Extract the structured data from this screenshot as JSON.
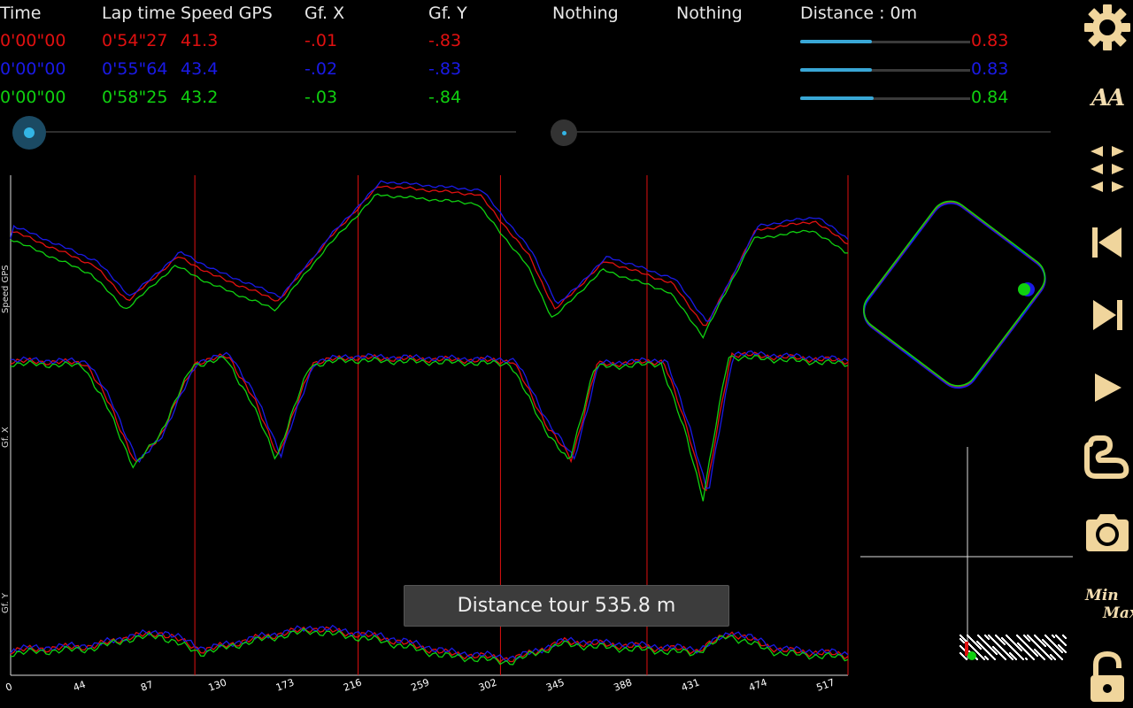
{
  "header": {
    "columns": [
      "Time",
      "Lap time",
      "Speed GPS",
      "Gf. X",
      "Gf. Y",
      "Nothing",
      "Nothing"
    ],
    "distance_label": "Distance : 0m"
  },
  "laps": [
    {
      "color": "#e01010",
      "time": "0'00\"00",
      "lap_time": "0'54\"27",
      "speed": "41.3",
      "gfx": "-.01",
      "gfy": "-.83",
      "dist_value": "0.83"
    },
    {
      "color": "#1a1ae6",
      "time": "0'00\"00",
      "lap_time": "0'55\"64",
      "speed": "43.4",
      "gfx": "-.02",
      "gfy": "-.83",
      "dist_value": "0.83"
    },
    {
      "color": "#10d010",
      "time": "0'00\"00",
      "lap_time": "0'58\"25",
      "speed": "43.2",
      "gfx": "-.03",
      "gfy": "-.84",
      "dist_value": "0.84"
    }
  ],
  "distance_bars_fill": [
    0.42,
    0.42,
    0.43
  ],
  "graph": {
    "y_labels": [
      "Speed GPS",
      "Gf. X",
      "Gf. Y"
    ],
    "x_ticks": [
      "0",
      "44",
      "87",
      "130",
      "173",
      "216",
      "259",
      "302",
      "345",
      "388",
      "431",
      "474",
      "517"
    ],
    "sector_markers": [
      0.22,
      0.415,
      0.585,
      0.76
    ]
  },
  "toast": "Distance tour 535.8 m",
  "toolbar": {
    "icons": [
      "settings-icon",
      "font-size-icon",
      "layout-icon",
      "skip-back-icon",
      "skip-forward-icon",
      "play-icon",
      "track-icon",
      "camera-icon",
      "min-max-icon",
      "lock-icon"
    ],
    "minmax_top": "Min",
    "minmax_bottom": "Max",
    "font_icon_text": "AA"
  }
}
